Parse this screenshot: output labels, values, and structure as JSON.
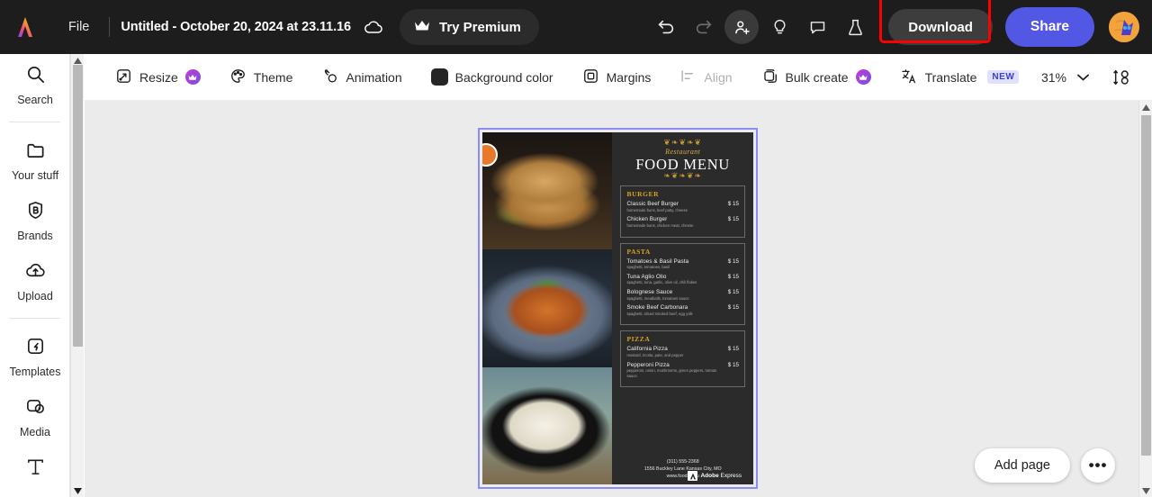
{
  "topbar": {
    "logo": "adobe-express-logo",
    "file_menu": "File",
    "document_title": "Untitled - October 20, 2024 at 23.11.16",
    "cloud_icon": "cloud-saved-icon",
    "try_premium": "Try Premium",
    "crown_icon": "crown-icon",
    "icons": [
      {
        "name": "undo-icon",
        "label": "Undo"
      },
      {
        "name": "redo-icon",
        "label": "Redo"
      },
      {
        "name": "invite-collaborator-icon",
        "label": "Invite"
      },
      {
        "name": "lightbulb-icon",
        "label": "Ideas"
      },
      {
        "name": "comment-icon",
        "label": "Comments"
      },
      {
        "name": "beaker-icon",
        "label": "Labs"
      }
    ],
    "download_label": "Download",
    "share_label": "Share",
    "avatar": "user-avatar",
    "highlight_color": "#ff0000",
    "share_color": "#5258e4"
  },
  "sidebar": {
    "items": [
      {
        "label": "Search",
        "icon": "search-icon"
      },
      {
        "label": "Your stuff",
        "icon": "folder-icon"
      },
      {
        "label": "Brands",
        "icon": "brand-badge-icon"
      },
      {
        "label": "Upload",
        "icon": "upload-cloud-icon"
      },
      {
        "label": "Templates",
        "icon": "templates-icon"
      },
      {
        "label": "Media",
        "icon": "media-icon"
      },
      {
        "label": "",
        "icon": "text-icon"
      }
    ]
  },
  "toolbar": {
    "tools": [
      {
        "label": "Resize",
        "icon": "resize-icon",
        "premium": true,
        "disabled": false
      },
      {
        "label": "Theme",
        "icon": "palette-icon",
        "premium": false,
        "disabled": false
      },
      {
        "label": "Animation",
        "icon": "animation-icon",
        "premium": false,
        "disabled": false
      },
      {
        "label": "Background color",
        "icon": "color-swatch-icon",
        "premium": false,
        "disabled": false
      },
      {
        "label": "Margins",
        "icon": "margins-icon",
        "premium": false,
        "disabled": false
      },
      {
        "label": "Align",
        "icon": "align-icon",
        "premium": false,
        "disabled": true
      },
      {
        "label": "Bulk create",
        "icon": "bulk-create-icon",
        "premium": true,
        "disabled": false
      },
      {
        "label": "Translate",
        "icon": "translate-icon",
        "premium": false,
        "disabled": false,
        "badge": "NEW"
      }
    ],
    "zoom_level": "31%",
    "zoom_chevron": "chevron-down-icon",
    "layers_icon": "reorder-layers-icon",
    "background_color_swatch": "#262626"
  },
  "canvas": {
    "background": "#ebebeb",
    "selection_color": "#8c8cf7",
    "page": {
      "background": "#2b2b2b",
      "photos": [
        {
          "name": "sandwich-photo",
          "alt": "Two submarine sandwiches on a wooden board"
        },
        {
          "name": "pasta-photo",
          "alt": "Bolognese pasta on a blue plate with basil"
        },
        {
          "name": "rice-photo",
          "alt": "White rice in a black pan with parsley"
        }
      ],
      "header": {
        "ornament_top": "ornament-flourish",
        "script": "Restaurant",
        "title": "FOOD MENU",
        "ornament_bottom": "ornament-flourish"
      },
      "sections": [
        {
          "title": "BURGER",
          "items": [
            {
              "name": "Classic Beef Burger",
              "desc": "homemade buns, beef patty, cheese",
              "price": "$ 15"
            },
            {
              "name": "Chicken Burger",
              "desc": "homemade buns, chicken meat, cheese",
              "price": "$ 15"
            }
          ]
        },
        {
          "title": "PASTA",
          "items": [
            {
              "name": "Tomatoes & Basil Pasta",
              "desc": "spaghetti, tomatoes, basil",
              "price": "$ 15"
            },
            {
              "name": "Tuna Aglio Olio",
              "desc": "spaghetti, tuna, garlic, olive oil, chili flakes",
              "price": "$ 15"
            },
            {
              "name": "Bolognese Sauce",
              "desc": "spaghetti, meatballs, tomatoes sauce",
              "price": "$ 15"
            },
            {
              "name": "Smoke Beef Carbonara",
              "desc": "spaghetti, sliced smoked beef, egg yolk",
              "price": "$ 15"
            }
          ]
        },
        {
          "title": "PIZZA",
          "items": [
            {
              "name": "California Pizza",
              "desc": "mustard, ricotta, pate, and pepper",
              "price": "$ 15"
            },
            {
              "name": "Pepperoni Pizza",
              "desc": "pepperoni, onion, mushrooms, green peppers, tomato sauce.",
              "price": "$ 15"
            }
          ]
        }
      ],
      "footer": {
        "phone": "(311) 555-2368",
        "address": "1556 Buckley Lane Kansas City, MO",
        "website": "www.foodmenu",
        "watermark_brand": "Adobe",
        "watermark_product": "Express"
      }
    }
  },
  "bottom_controls": {
    "add_page": "Add page",
    "more": "•••"
  }
}
